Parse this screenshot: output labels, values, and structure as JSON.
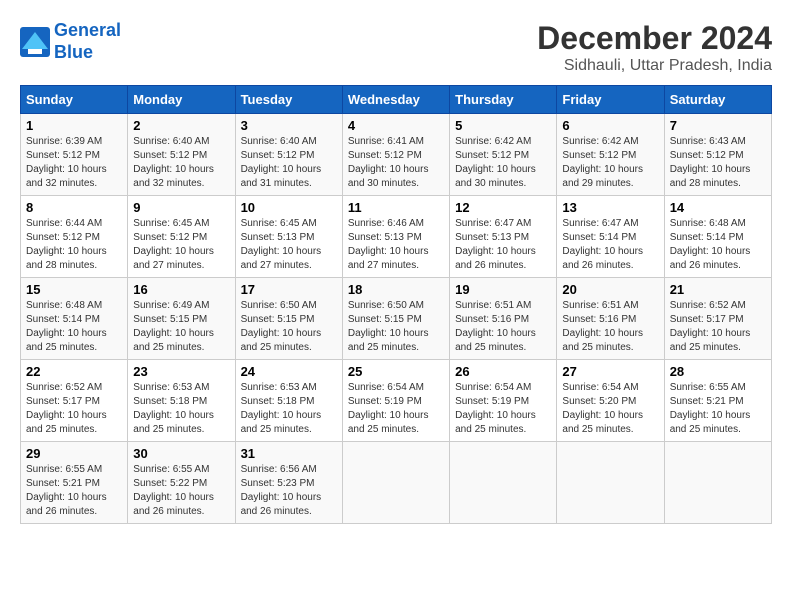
{
  "logo": {
    "line1": "General",
    "line2": "Blue"
  },
  "title": "December 2024",
  "location": "Sidhauli, Uttar Pradesh, India",
  "headers": [
    "Sunday",
    "Monday",
    "Tuesday",
    "Wednesday",
    "Thursday",
    "Friday",
    "Saturday"
  ],
  "weeks": [
    [
      {
        "day": "1",
        "sunrise": "Sunrise: 6:39 AM",
        "sunset": "Sunset: 5:12 PM",
        "daylight": "Daylight: 10 hours and 32 minutes."
      },
      {
        "day": "2",
        "sunrise": "Sunrise: 6:40 AM",
        "sunset": "Sunset: 5:12 PM",
        "daylight": "Daylight: 10 hours and 32 minutes."
      },
      {
        "day": "3",
        "sunrise": "Sunrise: 6:40 AM",
        "sunset": "Sunset: 5:12 PM",
        "daylight": "Daylight: 10 hours and 31 minutes."
      },
      {
        "day": "4",
        "sunrise": "Sunrise: 6:41 AM",
        "sunset": "Sunset: 5:12 PM",
        "daylight": "Daylight: 10 hours and 30 minutes."
      },
      {
        "day": "5",
        "sunrise": "Sunrise: 6:42 AM",
        "sunset": "Sunset: 5:12 PM",
        "daylight": "Daylight: 10 hours and 30 minutes."
      },
      {
        "day": "6",
        "sunrise": "Sunrise: 6:42 AM",
        "sunset": "Sunset: 5:12 PM",
        "daylight": "Daylight: 10 hours and 29 minutes."
      },
      {
        "day": "7",
        "sunrise": "Sunrise: 6:43 AM",
        "sunset": "Sunset: 5:12 PM",
        "daylight": "Daylight: 10 hours and 28 minutes."
      }
    ],
    [
      {
        "day": "8",
        "sunrise": "Sunrise: 6:44 AM",
        "sunset": "Sunset: 5:12 PM",
        "daylight": "Daylight: 10 hours and 28 minutes."
      },
      {
        "day": "9",
        "sunrise": "Sunrise: 6:45 AM",
        "sunset": "Sunset: 5:12 PM",
        "daylight": "Daylight: 10 hours and 27 minutes."
      },
      {
        "day": "10",
        "sunrise": "Sunrise: 6:45 AM",
        "sunset": "Sunset: 5:13 PM",
        "daylight": "Daylight: 10 hours and 27 minutes."
      },
      {
        "day": "11",
        "sunrise": "Sunrise: 6:46 AM",
        "sunset": "Sunset: 5:13 PM",
        "daylight": "Daylight: 10 hours and 27 minutes."
      },
      {
        "day": "12",
        "sunrise": "Sunrise: 6:47 AM",
        "sunset": "Sunset: 5:13 PM",
        "daylight": "Daylight: 10 hours and 26 minutes."
      },
      {
        "day": "13",
        "sunrise": "Sunrise: 6:47 AM",
        "sunset": "Sunset: 5:14 PM",
        "daylight": "Daylight: 10 hours and 26 minutes."
      },
      {
        "day": "14",
        "sunrise": "Sunrise: 6:48 AM",
        "sunset": "Sunset: 5:14 PM",
        "daylight": "Daylight: 10 hours and 26 minutes."
      }
    ],
    [
      {
        "day": "15",
        "sunrise": "Sunrise: 6:48 AM",
        "sunset": "Sunset: 5:14 PM",
        "daylight": "Daylight: 10 hours and 25 minutes."
      },
      {
        "day": "16",
        "sunrise": "Sunrise: 6:49 AM",
        "sunset": "Sunset: 5:15 PM",
        "daylight": "Daylight: 10 hours and 25 minutes."
      },
      {
        "day": "17",
        "sunrise": "Sunrise: 6:50 AM",
        "sunset": "Sunset: 5:15 PM",
        "daylight": "Daylight: 10 hours and 25 minutes."
      },
      {
        "day": "18",
        "sunrise": "Sunrise: 6:50 AM",
        "sunset": "Sunset: 5:15 PM",
        "daylight": "Daylight: 10 hours and 25 minutes."
      },
      {
        "day": "19",
        "sunrise": "Sunrise: 6:51 AM",
        "sunset": "Sunset: 5:16 PM",
        "daylight": "Daylight: 10 hours and 25 minutes."
      },
      {
        "day": "20",
        "sunrise": "Sunrise: 6:51 AM",
        "sunset": "Sunset: 5:16 PM",
        "daylight": "Daylight: 10 hours and 25 minutes."
      },
      {
        "day": "21",
        "sunrise": "Sunrise: 6:52 AM",
        "sunset": "Sunset: 5:17 PM",
        "daylight": "Daylight: 10 hours and 25 minutes."
      }
    ],
    [
      {
        "day": "22",
        "sunrise": "Sunrise: 6:52 AM",
        "sunset": "Sunset: 5:17 PM",
        "daylight": "Daylight: 10 hours and 25 minutes."
      },
      {
        "day": "23",
        "sunrise": "Sunrise: 6:53 AM",
        "sunset": "Sunset: 5:18 PM",
        "daylight": "Daylight: 10 hours and 25 minutes."
      },
      {
        "day": "24",
        "sunrise": "Sunrise: 6:53 AM",
        "sunset": "Sunset: 5:18 PM",
        "daylight": "Daylight: 10 hours and 25 minutes."
      },
      {
        "day": "25",
        "sunrise": "Sunrise: 6:54 AM",
        "sunset": "Sunset: 5:19 PM",
        "daylight": "Daylight: 10 hours and 25 minutes."
      },
      {
        "day": "26",
        "sunrise": "Sunrise: 6:54 AM",
        "sunset": "Sunset: 5:19 PM",
        "daylight": "Daylight: 10 hours and 25 minutes."
      },
      {
        "day": "27",
        "sunrise": "Sunrise: 6:54 AM",
        "sunset": "Sunset: 5:20 PM",
        "daylight": "Daylight: 10 hours and 25 minutes."
      },
      {
        "day": "28",
        "sunrise": "Sunrise: 6:55 AM",
        "sunset": "Sunset: 5:21 PM",
        "daylight": "Daylight: 10 hours and 25 minutes."
      }
    ],
    [
      {
        "day": "29",
        "sunrise": "Sunrise: 6:55 AM",
        "sunset": "Sunset: 5:21 PM",
        "daylight": "Daylight: 10 hours and 26 minutes."
      },
      {
        "day": "30",
        "sunrise": "Sunrise: 6:55 AM",
        "sunset": "Sunset: 5:22 PM",
        "daylight": "Daylight: 10 hours and 26 minutes."
      },
      {
        "day": "31",
        "sunrise": "Sunrise: 6:56 AM",
        "sunset": "Sunset: 5:23 PM",
        "daylight": "Daylight: 10 hours and 26 minutes."
      },
      null,
      null,
      null,
      null
    ]
  ]
}
